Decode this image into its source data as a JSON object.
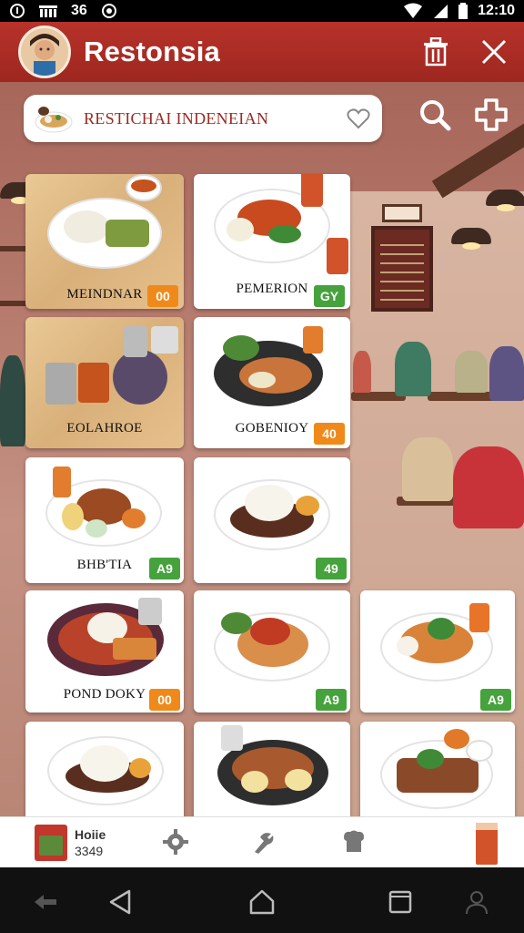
{
  "status_bar": {
    "left_items": [
      "єу",
      "аб"
    ],
    "text_b": "36",
    "time": "12:10"
  },
  "app": {
    "title": "Restonsia",
    "icons": [
      "avatar",
      "trash-icon",
      "close-icon"
    ]
  },
  "search": {
    "value": "RESTICHAI INDENEIAN",
    "icons": [
      "heart-icon",
      "search-icon",
      "add-icon"
    ]
  },
  "cards": [
    {
      "label": "MEINDNAR",
      "price": "00",
      "badge_color": "#ef8a1a",
      "style": "wood"
    },
    {
      "label": "PEMERION",
      "price": "GY",
      "badge_color": "#46a23c",
      "style": "white"
    },
    {
      "label": "EOLAHROE",
      "price": "",
      "badge_color": "",
      "style": "wood"
    },
    {
      "label": "GOBENIOY",
      "price": "40",
      "badge_color": "#ef8a1a",
      "style": "white"
    },
    {
      "label": "BHB'TIA",
      "price": "A9",
      "badge_color": "#46a23c",
      "style": "white"
    },
    {
      "label": "",
      "price": "49",
      "badge_color": "#46a23c",
      "style": "white"
    },
    {
      "label": "POND DOKY",
      "price": "00",
      "badge_color": "#ef8a1a",
      "style": "white"
    },
    {
      "label": "",
      "price": "A9",
      "badge_color": "#46a23c",
      "style": "white"
    },
    {
      "label": "",
      "price": "A9",
      "badge_color": "#46a23c",
      "style": "white"
    },
    {
      "label": "",
      "price": "",
      "badge_color": "",
      "style": "white"
    },
    {
      "label": "",
      "price": "",
      "badge_color": "",
      "style": "white"
    },
    {
      "label": "",
      "price": "",
      "badge_color": "",
      "style": "white"
    }
  ],
  "bottom_nav": {
    "home_title": "Hoiie",
    "home_sub": "3349",
    "icons": [
      "settings-icon",
      "tools-icon",
      "bread-icon",
      "drink-icon"
    ]
  },
  "system_nav": {
    "icons": [
      "back-arrow-icon",
      "back-icon",
      "home-icon",
      "recents-icon",
      "person-icon"
    ]
  },
  "colors": {
    "app_bar": "#b7322a",
    "accent_text": "#9b2a22",
    "badge_orange": "#ef8a1a",
    "badge_green": "#46a23c"
  }
}
